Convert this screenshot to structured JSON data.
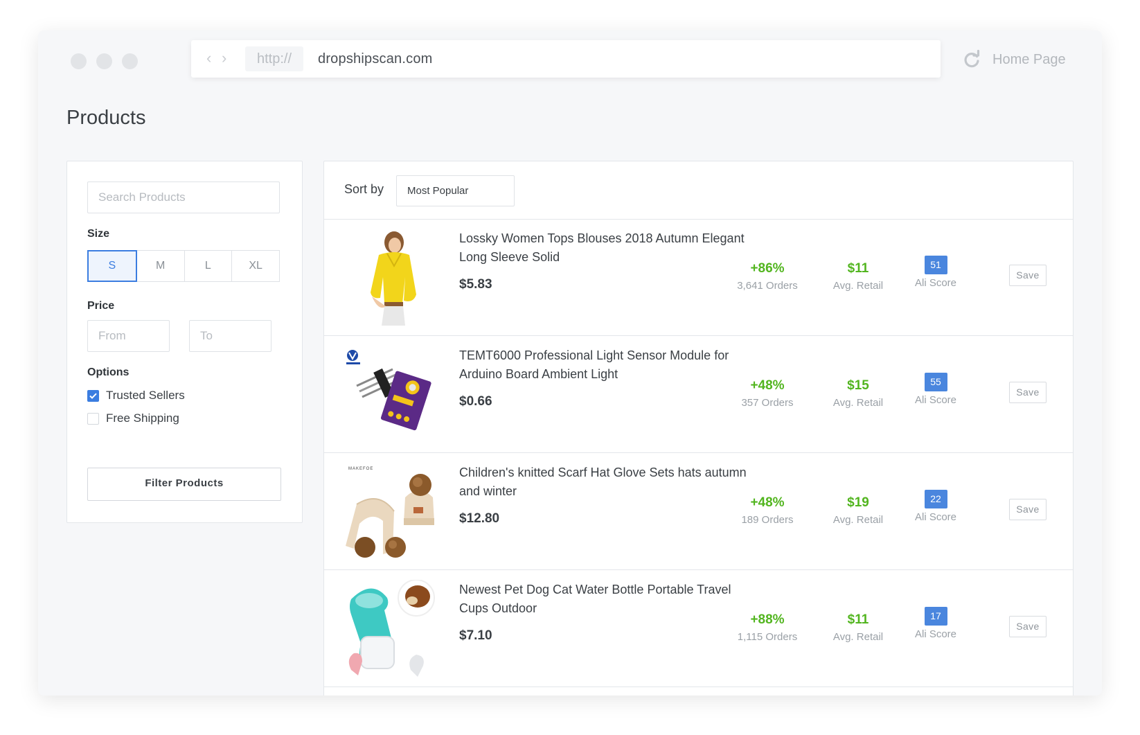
{
  "browser": {
    "http_prefix": "http://",
    "url": "dropshipscan.com",
    "home_link": "Home Page",
    "back_symbol": "‹",
    "forward_symbol": "›"
  },
  "page": {
    "title": "Products"
  },
  "filters": {
    "search_placeholder": "Search Products",
    "size_label": "Size",
    "sizes": [
      "S",
      "M",
      "L",
      "XL"
    ],
    "selected_size": "S",
    "price_label": "Price",
    "price_from_placeholder": "From",
    "price_to_placeholder": "To",
    "options_label": "Options",
    "options": [
      {
        "label": "Trusted Sellers",
        "checked": true
      },
      {
        "label": "Free Shipping",
        "checked": false
      }
    ],
    "filter_button": "Filter Products"
  },
  "sort": {
    "label": "Sort by",
    "value": "Most Popular"
  },
  "products": [
    {
      "title": "Lossky Women Tops Blouses 2018 Autumn Elegant Long Sleeve Solid",
      "price": "$5.83",
      "growth": "+86%",
      "orders": "3,641 Orders",
      "avg_retail": "$11",
      "avg_retail_label": "Avg. Retail",
      "ali_score": "51",
      "ali_score_label": "Ali Score",
      "save_label": "Save"
    },
    {
      "title": "TEMT6000 Professional Light Sensor Module for Arduino Board Ambient Light",
      "price": "$0.66",
      "growth": "+48%",
      "orders": "357 Orders",
      "avg_retail": "$15",
      "avg_retail_label": "Avg. Retail",
      "ali_score": "55",
      "ali_score_label": "Ali Score",
      "save_label": "Save"
    },
    {
      "title": "Children's knitted Scarf Hat Glove Sets hats autumn and winter",
      "price": "$12.80",
      "growth": "+48%",
      "orders": "189 Orders",
      "avg_retail": "$19",
      "avg_retail_label": "Avg. Retail",
      "ali_score": "22",
      "ali_score_label": "Ali Score",
      "save_label": "Save",
      "thumb_logo": "MAKEFOE"
    },
    {
      "title": "Newest Pet Dog Cat Water Bottle Portable Travel Cups Outdoor",
      "price": "$7.10",
      "growth": "+88%",
      "orders": "1,115 Orders",
      "avg_retail": "$11",
      "avg_retail_label": "Avg. Retail",
      "ali_score": "17",
      "ali_score_label": "Ali Score",
      "save_label": "Save"
    }
  ],
  "colors": {
    "accent": "#3b7de0",
    "positive": "#52b51f",
    "badge": "#4a86de"
  }
}
